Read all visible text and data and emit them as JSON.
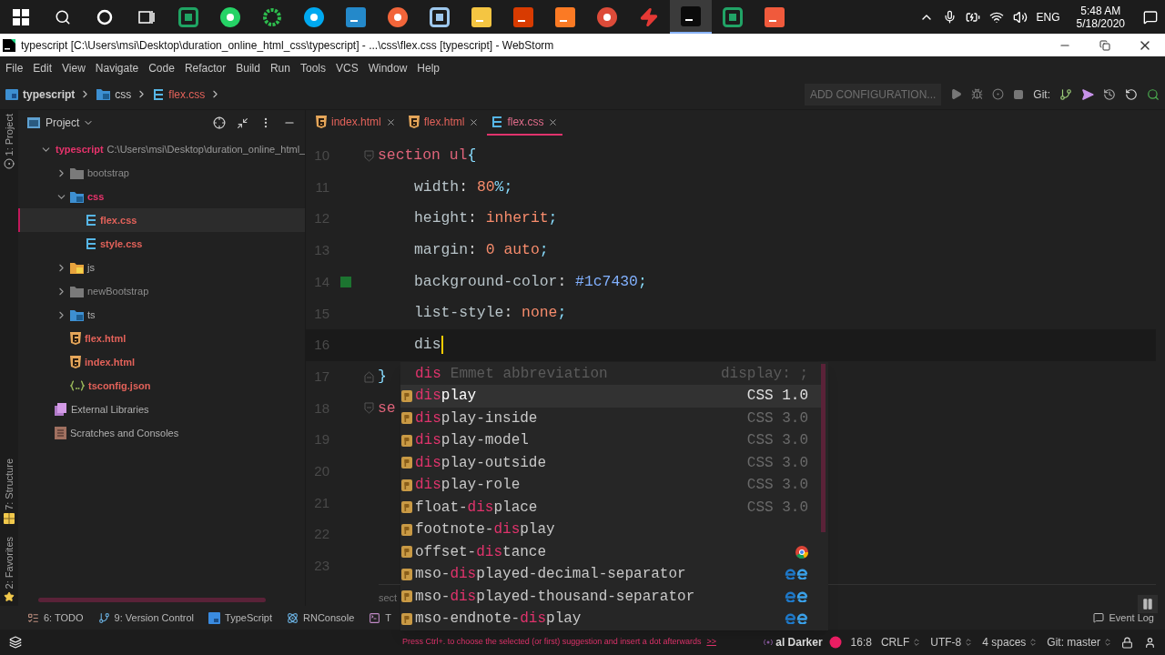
{
  "taskbar": {
    "apps": [
      {
        "kind": "windows",
        "selected": false
      },
      {
        "kind": "search",
        "selected": false
      },
      {
        "kind": "cortana",
        "selected": false
      },
      {
        "kind": "taskview",
        "selected": false
      },
      {
        "kind": "tile-outline",
        "color": "#1fa463",
        "selected": false
      },
      {
        "kind": "round",
        "color": "#25d366",
        "selected": false
      },
      {
        "kind": "ring",
        "color": "#2ebd4e",
        "selected": false
      },
      {
        "kind": "round",
        "color": "#00a9f0",
        "selected": false
      },
      {
        "kind": "tile",
        "color": "#2489ca",
        "selected": false
      },
      {
        "kind": "round",
        "color": "#f2653a",
        "selected": false
      },
      {
        "kind": "tile-outline",
        "color": "#9ec8ee",
        "selected": false
      },
      {
        "kind": "tile",
        "color": "#f4c542",
        "selected": false
      },
      {
        "kind": "tile",
        "color": "#d83b01",
        "selected": false
      },
      {
        "kind": "tile",
        "color": "#fb7a24",
        "selected": false
      },
      {
        "kind": "round",
        "color": "#dd4b39",
        "selected": false
      },
      {
        "kind": "bolt",
        "color": "#e53935",
        "selected": false
      },
      {
        "kind": "tile",
        "color": "#0b0b0b",
        "selected": true
      },
      {
        "kind": "tile-outline",
        "color": "#21a366",
        "selected": false
      },
      {
        "kind": "tile",
        "color": "#f05a3c",
        "selected": false
      }
    ],
    "language": "ENG",
    "time": "5:48 AM",
    "date": "5/18/2020"
  },
  "window": {
    "title": "typescript [C:\\Users\\msi\\Desktop\\duration_online_html_css\\typescript] - ...\\css\\flex.css [typescript] - WebStorm"
  },
  "menu": [
    "File",
    "Edit",
    "View",
    "Navigate",
    "Code",
    "Refactor",
    "Build",
    "Run",
    "Tools",
    "VCS",
    "Window",
    "Help"
  ],
  "breadcrumbs": [
    {
      "kind": "project",
      "label": "typescript"
    },
    {
      "kind": "folder",
      "label": "css"
    },
    {
      "kind": "css",
      "label": "flex.css"
    }
  ],
  "toolbar": {
    "run_config": "ADD CONFIGURATION...",
    "git_label": "Git:"
  },
  "side_stripe": {
    "top": [
      {
        "kind": "project",
        "label": "1: Project"
      }
    ],
    "bottom": [
      {
        "kind": "structure",
        "label": "7: Structure"
      },
      {
        "kind": "favorites",
        "label": "2: Favorites"
      }
    ]
  },
  "project": {
    "title": "Project",
    "tree": [
      {
        "kind": "project",
        "label": "typescript",
        "path": "C:\\Users\\msi\\Desktop\\duration_online_html_",
        "expanded": true,
        "selected": false,
        "color": "#e8336c",
        "children": [
          {
            "kind": "folder",
            "label": "bootstrap",
            "expanded": false,
            "selected": false,
            "color": "#8c8c8c"
          },
          {
            "kind": "folder-css",
            "label": "css",
            "expanded": true,
            "selected": false,
            "color": "#e8336c",
            "children": [
              {
                "kind": "css",
                "label": "flex.css",
                "selected": true,
                "color": "#e3625a"
              },
              {
                "kind": "css",
                "label": "style.css",
                "selected": false,
                "color": "#e3625a"
              }
            ]
          },
          {
            "kind": "folder-js",
            "label": "js",
            "expanded": false,
            "selected": false
          },
          {
            "kind": "folder",
            "label": "newBootstrap",
            "expanded": false,
            "selected": false,
            "color": "#8c8c8c"
          },
          {
            "kind": "folder-ts",
            "label": "ts",
            "expanded": false,
            "selected": false
          },
          {
            "kind": "html",
            "label": "flex.html",
            "selected": false,
            "color": "#e3625a"
          },
          {
            "kind": "html",
            "label": "index.html",
            "selected": false,
            "color": "#e3625a"
          },
          {
            "kind": "json",
            "label": "tsconfig.json",
            "selected": false,
            "color": "#e3625a"
          }
        ]
      },
      {
        "kind": "libraries",
        "label": "External Libraries",
        "selected": false
      },
      {
        "kind": "scratches",
        "label": "Scratches and Consoles",
        "selected": false
      }
    ]
  },
  "tabs": [
    {
      "kind": "html",
      "label": "index.html",
      "selected": false
    },
    {
      "kind": "html",
      "label": "flex.html",
      "selected": false
    },
    {
      "kind": "css",
      "label": "flex.css",
      "selected": true
    }
  ],
  "editor": {
    "lines": [
      {
        "number": "10",
        "fold_start": true,
        "tokens": [
          {
            "kind": "selector",
            "text": "section ul"
          },
          {
            "kind": "punct",
            "text": "{"
          }
        ]
      },
      {
        "number": "11",
        "indented": true,
        "tokens": [
          {
            "kind": "property",
            "text": "width"
          },
          {
            "kind": "plain",
            "text": ": "
          },
          {
            "kind": "value",
            "text": "80"
          },
          {
            "kind": "punct",
            "text": "%;"
          }
        ]
      },
      {
        "number": "12",
        "indented": true,
        "tokens": [
          {
            "kind": "property",
            "text": "height"
          },
          {
            "kind": "plain",
            "text": ": "
          },
          {
            "kind": "value",
            "text": "inherit"
          },
          {
            "kind": "punct",
            "text": ";"
          }
        ]
      },
      {
        "number": "13",
        "indented": true,
        "tokens": [
          {
            "kind": "property",
            "text": "margin"
          },
          {
            "kind": "plain",
            "text": ": "
          },
          {
            "kind": "value",
            "text": "0 auto"
          },
          {
            "kind": "punct",
            "text": ";"
          }
        ]
      },
      {
        "number": "14",
        "indented": true,
        "tokens": [
          {
            "kind": "property",
            "text": "background-color"
          },
          {
            "kind": "plain",
            "text": ": "
          },
          {
            "kind": "color",
            "text": "#1c7430"
          },
          {
            "kind": "punct",
            "text": ";"
          }
        ]
      },
      {
        "number": "15",
        "indented": true,
        "tokens": [
          {
            "kind": "property",
            "text": "list-style"
          },
          {
            "kind": "plain",
            "text": ": "
          },
          {
            "kind": "value",
            "text": "none"
          },
          {
            "kind": "punct",
            "text": ";"
          }
        ]
      },
      {
        "number": "16",
        "indented": true,
        "current": true,
        "tokens": [
          {
            "kind": "property",
            "text": "dis"
          }
        ]
      },
      {
        "number": "17",
        "fold_end": true,
        "tokens": [
          {
            "kind": "punct",
            "text": "}"
          }
        ]
      },
      {
        "number": "18",
        "fold_start": true,
        "tokens": [
          {
            "kind": "selector",
            "text": "se"
          }
        ]
      },
      {
        "number": "19"
      },
      {
        "number": "20"
      },
      {
        "number": "21"
      },
      {
        "number": "22"
      },
      {
        "number": "23"
      }
    ],
    "breadcrumb": "sect"
  },
  "popup": {
    "emmet": {
      "abbr": "dis",
      "description": "Emmet abbreviation",
      "expansion": "display: ;"
    },
    "items": [
      {
        "match": "dis",
        "after": "play",
        "source": "CSS 1.0",
        "selected": true
      },
      {
        "match": "dis",
        "after": "play-inside",
        "source": "CSS 3.0",
        "selected": false
      },
      {
        "match": "dis",
        "after": "play-model",
        "source": "CSS 3.0",
        "selected": false
      },
      {
        "match": "dis",
        "after": "play-outside",
        "source": "CSS 3.0",
        "selected": false
      },
      {
        "match": "dis",
        "after": "play-role",
        "source": "CSS 3.0",
        "selected": false
      },
      {
        "before": "float-",
        "match": "dis",
        "after": "place",
        "source": "CSS 3.0",
        "selected": false
      },
      {
        "before": "footnote-",
        "match": "dis",
        "after": "play",
        "selected": false
      },
      {
        "before": "offset-",
        "match": "dis",
        "after": "tance",
        "browsers": [
          {
            "kind": "chrome"
          }
        ],
        "selected": false
      },
      {
        "before": "mso-",
        "match": "dis",
        "after": "played-decimal-separator",
        "browsers": [
          {
            "kind": "ie"
          },
          {
            "kind": "edge"
          }
        ],
        "selected": false
      },
      {
        "before": "mso-",
        "match": "dis",
        "after": "played-thousand-separator",
        "browsers": [
          {
            "kind": "ie"
          },
          {
            "kind": "edge"
          }
        ],
        "selected": false
      },
      {
        "before": "mso-endnote-",
        "match": "dis",
        "after": "play",
        "browsers": [
          {
            "kind": "ie"
          },
          {
            "kind": "edge"
          }
        ],
        "selected": false
      }
    ]
  },
  "tool_windows": [
    {
      "kind": "todo",
      "label": "6: TODO"
    },
    {
      "kind": "vcs",
      "label": "9: Version Control"
    },
    {
      "kind": "typescript",
      "label": "TypeScript"
    },
    {
      "kind": "react",
      "label": "RNConsole"
    },
    {
      "kind": "terminal",
      "label": "T"
    }
  ],
  "event_log": "Event Log",
  "status_bar": {
    "hint": "Press Ctrl+. to choose the selected (or first) suggestion and insert a dot afterwards",
    "hint_link": ">>",
    "theme": "al Darker",
    "items": [
      "16:8",
      "CRLF",
      "UTF-8",
      "4 spaces",
      "Git: master"
    ]
  }
}
